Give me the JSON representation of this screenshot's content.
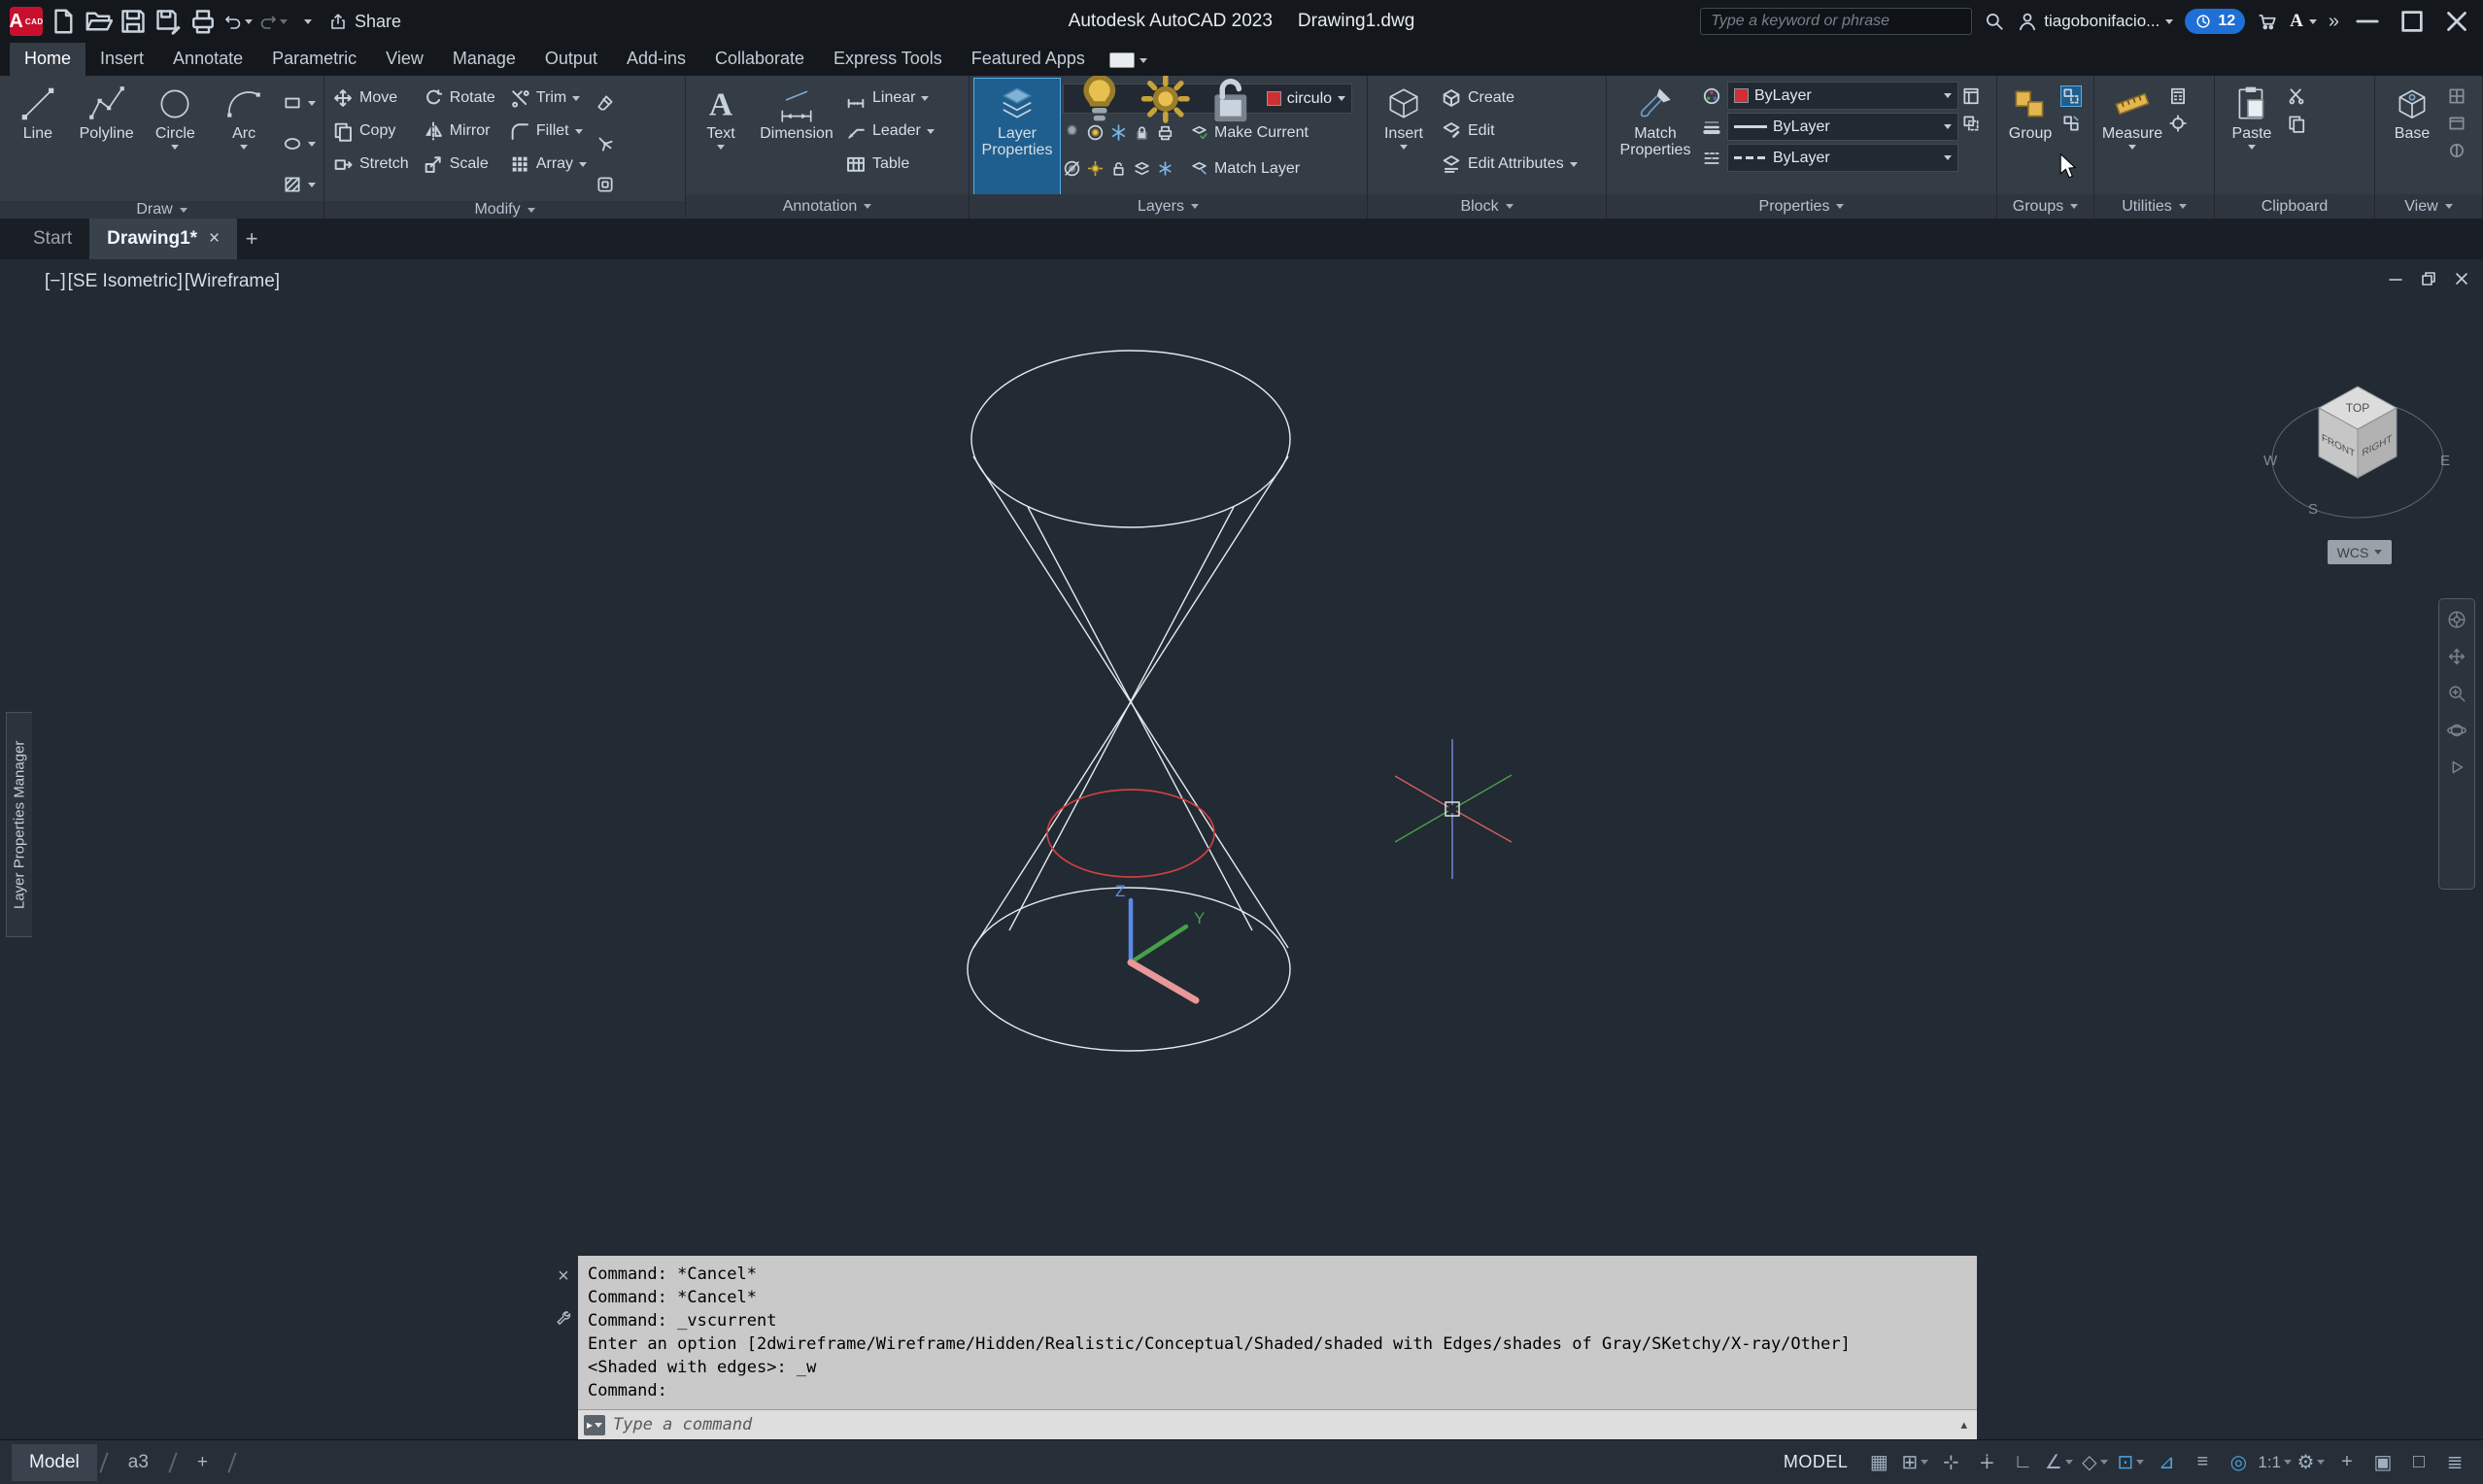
{
  "titlebar": {
    "logo_letter": "A",
    "logo_sub": "CAD",
    "share_label": "Share",
    "app_title": "Autodesk AutoCAD 2023",
    "doc_title": "Drawing1.dwg",
    "search_placeholder": "Type a keyword or phrase",
    "user_name": "tiagobonifacio...",
    "trial_badge": "12",
    "adsk_letter": "A"
  },
  "ribbon": {
    "tabs": [
      "Home",
      "Insert",
      "Annotate",
      "Parametric",
      "View",
      "Manage",
      "Output",
      "Add-ins",
      "Collaborate",
      "Express Tools",
      "Featured Apps"
    ],
    "panels": {
      "draw": {
        "label": "Draw",
        "buttons": [
          "Line",
          "Polyline",
          "Circle",
          "Arc"
        ]
      },
      "modify": {
        "label": "Modify",
        "buttons": [
          "Move",
          "Rotate",
          "Trim",
          "Copy",
          "Mirror",
          "Fillet",
          "Stretch",
          "Scale",
          "Array"
        ]
      },
      "annotation": {
        "label": "Annotation",
        "big": [
          "Text",
          "Dimension"
        ],
        "buttons": [
          "Linear",
          "Leader",
          "Table"
        ]
      },
      "layers": {
        "label": "Layers",
        "big": "Layer Properties",
        "current_layer": "circulo",
        "buttons": [
          "Make Current",
          "Match Layer"
        ]
      },
      "block": {
        "label": "Block",
        "big": "Insert",
        "buttons": [
          "Create",
          "Edit",
          "Edit Attributes"
        ]
      },
      "properties": {
        "label": "Properties",
        "big": "Match Properties",
        "values": [
          "ByLayer",
          "ByLayer",
          "ByLayer"
        ]
      },
      "groups": {
        "label": "Groups",
        "big": "Group"
      },
      "utilities": {
        "label": "Utilities",
        "big": "Measure"
      },
      "clipboard": {
        "label": "Clipboard",
        "big": "Paste"
      },
      "view": {
        "label": "View",
        "big": "Base"
      }
    }
  },
  "file_tabs": {
    "start": "Start",
    "active": "Drawing1*",
    "new": "+"
  },
  "viewport": {
    "controls": "[−]",
    "view_name": "[SE Isometric]",
    "visual_style": "[Wireframe]",
    "axis_z": "Z",
    "axis_y": "Y",
    "viewcube": {
      "top": "TOP",
      "front": "FRONT",
      "right": "RIGHT",
      "w": "W",
      "s": "S",
      "e": "E",
      "wcs": "WCS"
    }
  },
  "palette_tab": "Layer Properties Manager",
  "command": {
    "lines": [
      "Command: *Cancel*",
      "Command: *Cancel*",
      "Command: _vscurrent",
      "Enter an option [2dwireframe/Wireframe/Hidden/Realistic/Conceptual/Shaded/shaded with Edges/shades of Gray/SKetchy/X-ray/Other]",
      "<Shaded with edges>: _w",
      "Command:"
    ],
    "placeholder": "Type a command"
  },
  "statusbar": {
    "model_tab": "Model",
    "layout_tab": "a3",
    "new_layout": "+",
    "model_space": "MODEL",
    "tools": [
      {
        "name": "grid",
        "glyph": "▦"
      },
      {
        "name": "snap-mode",
        "glyph": "⊞"
      },
      {
        "name": "infer-constraints",
        "glyph": "⊹"
      },
      {
        "name": "dynamic-input",
        "glyph": "∔"
      },
      {
        "name": "ortho",
        "glyph": "∟"
      },
      {
        "name": "polar-tracking",
        "glyph": "∠"
      },
      {
        "name": "isodraft",
        "glyph": "◇"
      },
      {
        "name": "object-snap",
        "glyph": "⊡"
      },
      {
        "name": "object-snap-tracking",
        "glyph": "⊿"
      },
      {
        "name": "lineweight",
        "glyph": "≡"
      },
      {
        "name": "selection-cycling",
        "glyph": "◎"
      },
      {
        "name": "annotation-scale",
        "glyph": "1:1"
      },
      {
        "name": "workspace",
        "glyph": "⚙"
      },
      {
        "name": "annotation-autoscale",
        "glyph": "+"
      },
      {
        "name": "isolate-objects",
        "glyph": "▣"
      },
      {
        "name": "hardware-acceleration",
        "glyph": "□"
      },
      {
        "name": "customization",
        "glyph": "≣"
      }
    ]
  },
  "icons": {
    "close": "×",
    "scroll_up": "▴",
    "guillemet": "»"
  },
  "colors": {
    "accent": "#4aa3e0",
    "red_circle": "#d04040",
    "axis_x": "#e89898",
    "axis_y": "#46a048",
    "axis_z": "#5b8ae6",
    "layer_color": "#d03030"
  }
}
